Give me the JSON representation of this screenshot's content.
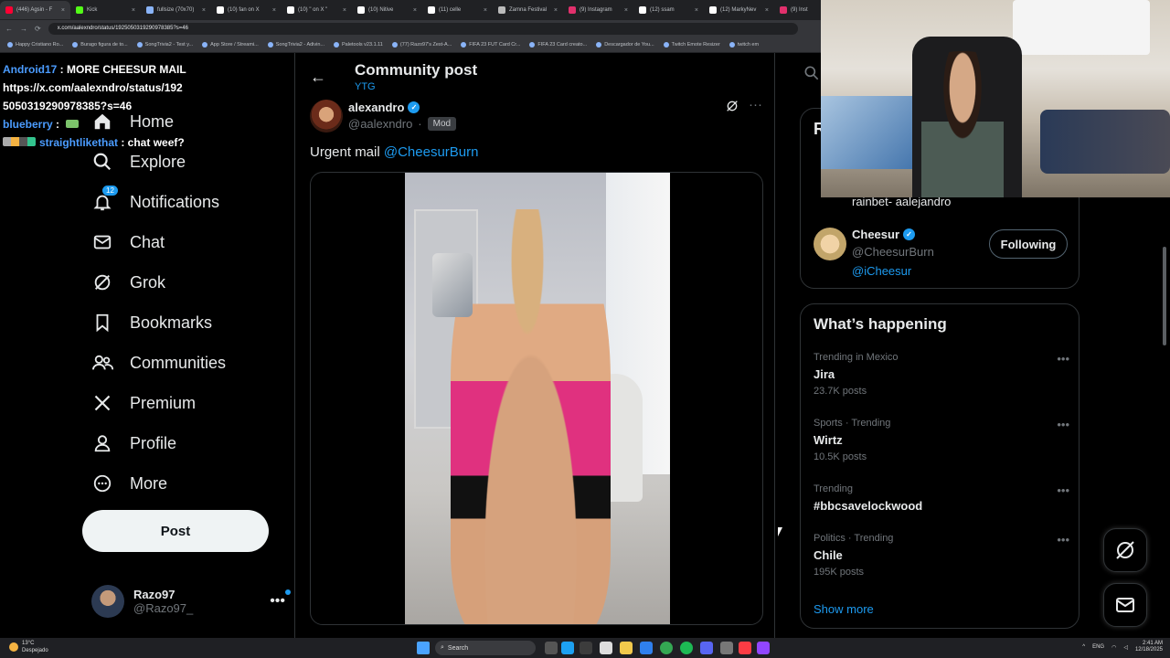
{
  "browser": {
    "tabs": [
      {
        "label": "(446) Agsin - F",
        "color": "#ff0033"
      },
      {
        "label": "Kick",
        "color": "#53fc18"
      },
      {
        "label": "fullsize (70x70)",
        "color": "#8ab4f8"
      },
      {
        "label": "(10) fan on X",
        "color": "#ffffff"
      },
      {
        "label": "(10) \" on X \"",
        "color": "#ffffff"
      },
      {
        "label": "(10) Nitive",
        "color": "#ffffff"
      },
      {
        "label": "(11) celle",
        "color": "#ffffff"
      },
      {
        "label": "Zamna Festival",
        "color": "#bbbbbb"
      },
      {
        "label": "(9) Instagram",
        "color": "#e1306c"
      },
      {
        "label": "(12) ssam",
        "color": "#ffffff"
      },
      {
        "label": "(12) MarkyNev",
        "color": "#ffffff"
      },
      {
        "label": "(9) Inst",
        "color": "#e1306c"
      }
    ],
    "url": "x.com/aalexndro/status/1925050319290978385?s=46",
    "bookmarks": [
      "Happy Cristiano Ro...",
      "Burago figura de to...",
      "SongTrivia2 - Test y...",
      "App Store / Streami...",
      "SongTrivia2 - Adivin...",
      "Paletools v23.1.11",
      "(77) Razo97's Zest-A...",
      "FIFA 23 FUT Card Cr...",
      "FIFA 23 Card creato...",
      "Descargador de You...",
      "Twitch Emote Resizer",
      "twitch em"
    ]
  },
  "chat": [
    {
      "user": "Android17",
      "msg": " : MORE CHEESUR MAIL"
    },
    {
      "user": "",
      "msg": "https://x.com/aalexndro/status/192"
    },
    {
      "user": "",
      "msg": "5050319290978385?s=46"
    },
    {
      "user": "blueberry",
      "msg": " : "
    },
    {
      "user": "straightlikethat",
      "msg": " : chat weef?"
    }
  ],
  "nav": {
    "items": [
      {
        "label": "Home",
        "icon": "home-icon"
      },
      {
        "label": "Explore",
        "icon": "search-icon"
      },
      {
        "label": "Notifications",
        "icon": "bell-icon",
        "badge": "12"
      },
      {
        "label": "Chat",
        "icon": "mail-icon"
      },
      {
        "label": "Grok",
        "icon": "grok-icon"
      },
      {
        "label": "Bookmarks",
        "icon": "bookmark-icon"
      },
      {
        "label": "Communities",
        "icon": "communities-icon"
      },
      {
        "label": "Premium",
        "icon": "x-logo-icon"
      },
      {
        "label": "Profile",
        "icon": "profile-icon"
      },
      {
        "label": "More",
        "icon": "more-circle-icon"
      }
    ],
    "post_button": "Post",
    "account": {
      "name": "Razo97",
      "handle": "@Razo97_",
      "more": "•••"
    }
  },
  "post": {
    "header_title": "Community post",
    "header_sub": "YTG",
    "author_name": "alexandro",
    "author_handle": "@aalexndro",
    "separator": "·",
    "badge": "Mod",
    "text_prefix": "Urgent mail ",
    "mention": "@CheesurBurn",
    "more": "···"
  },
  "sidebar": {
    "top_card_heading": "R",
    "rainbet_text": "rainbet- aalejandro",
    "follow_card": {
      "name": "Cheesur",
      "handle": "@CheesurBurn",
      "link": "@iCheesur",
      "button": "Following"
    },
    "happening": {
      "title": "What’s happening",
      "trends": [
        {
          "category": "Trending in Mexico",
          "name": "Jira",
          "count": "23.7K posts"
        },
        {
          "category": "Sports · Trending",
          "name": "Wirtz",
          "count": "10.5K posts"
        },
        {
          "category": "Trending",
          "name": "#bbcsavelockwood",
          "count": ""
        },
        {
          "category": "Politics · Trending",
          "name": "Chile",
          "count": "195K posts"
        }
      ],
      "show_more": "Show more"
    }
  },
  "taskbar": {
    "weather_temp": "13°C",
    "weather_desc": "Despejado",
    "search": "Search",
    "lang": "ENG",
    "time": "2:41 AM",
    "date": "12/18/2025"
  },
  "colors": {
    "accent": "#1d9bf0",
    "background": "#000000",
    "border": "#2f3336",
    "muted": "#71767b"
  }
}
